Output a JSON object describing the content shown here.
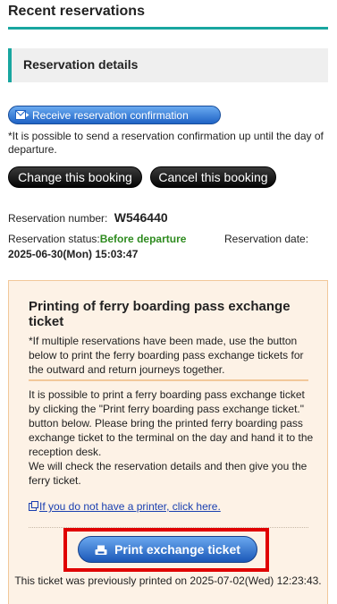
{
  "page": {
    "title": "Recent reservations"
  },
  "section": {
    "heading": "Reservation details"
  },
  "confirmation": {
    "button_label": "Receive reservation confirmation",
    "note": "*It is possible to send a reservation confirmation up until the day of departure."
  },
  "actions": {
    "change_label": "Change this booking",
    "cancel_label": "Cancel this booking"
  },
  "reservation": {
    "number_label": "Reservation number:",
    "number": "W546440",
    "status_label": "Reservation status:",
    "status": "Before departure",
    "date_label": "Reservation date:",
    "date": "2025-06-30(Mon) 15:03:47"
  },
  "print_panel": {
    "title": "Printing of ferry boarding pass exchange ticket",
    "multi_note": "*If multiple reservations have been made, use the button below to print the ferry boarding pass exchange tickets for the outward and return journeys together.",
    "body": "It is possible to print a ferry boarding pass exchange ticket by clicking the \"Print ferry boarding pass exchange ticket.\" button below. Please bring the printed ferry boarding pass exchange ticket to the terminal on the day and hand it to the reception desk.\nWe will check the reservation details and then give you the ferry ticket.",
    "printer_link": "If you do not have a printer, click here.",
    "print_button": "Print exchange ticket",
    "printed_note": "This ticket was previously printed on 2025-07-02(Wed) 12:23:43."
  },
  "colors": {
    "accent": "#19a6a0",
    "status_green": "#2e8b1f",
    "highlight_red": "#e00000",
    "panel_bg": "#fdf2e6"
  }
}
